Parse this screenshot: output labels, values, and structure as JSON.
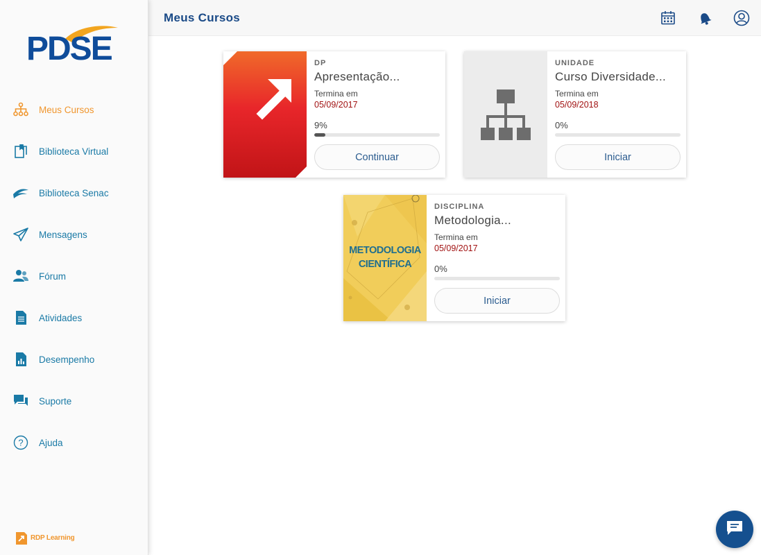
{
  "brand": {
    "logo_text": "PDSE",
    "footer_logo_text": "RDP Learning"
  },
  "colors": {
    "primary": "#1a4a87",
    "accent": "#f0962e",
    "link": "#1a7aa6",
    "date": "#a11212"
  },
  "sidebar": {
    "items": [
      {
        "label": "Meus Cursos",
        "icon": "hierarchy-icon",
        "active": true
      },
      {
        "label": "Biblioteca Virtual",
        "icon": "library-book-icon"
      },
      {
        "label": "Biblioteca Senac",
        "icon": "senac-bird-icon"
      },
      {
        "label": "Mensagens",
        "icon": "paper-plane-icon"
      },
      {
        "label": "Fórum",
        "icon": "users-icon"
      },
      {
        "label": "Atividades",
        "icon": "document-icon"
      },
      {
        "label": "Desempenho",
        "icon": "chart-document-icon"
      },
      {
        "label": "Suporte",
        "icon": "chat-bubbles-icon"
      },
      {
        "label": "Ajuda",
        "icon": "help-circle-icon"
      }
    ]
  },
  "header": {
    "title": "Meus Cursos",
    "icons": [
      "calendar-icon",
      "bell-icon",
      "user-profile-icon"
    ]
  },
  "courses": [
    {
      "kind": "DP",
      "title": "Apresentação...",
      "ends_label": "Termina em",
      "ends_date": "05/09/2017",
      "progress_text": "9%",
      "progress": 0.09,
      "button": "Continuar"
    },
    {
      "kind": "UNIDADE",
      "title": "Curso Diversidade...",
      "ends_label": "Termina em",
      "ends_date": "05/09/2018",
      "progress_text": "0%",
      "progress": 0,
      "button": "Iniciar"
    },
    {
      "kind": "DISCIPLINA",
      "title": "Metodologia...",
      "ends_label": "Termina em",
      "ends_date": "05/09/2017",
      "progress_text": "0%",
      "progress": 0,
      "button": "Iniciar",
      "thumb_text": [
        "METODOLOGIA",
        "CIENTÍFICA"
      ]
    }
  ],
  "fab": {
    "icon": "chat-icon"
  }
}
